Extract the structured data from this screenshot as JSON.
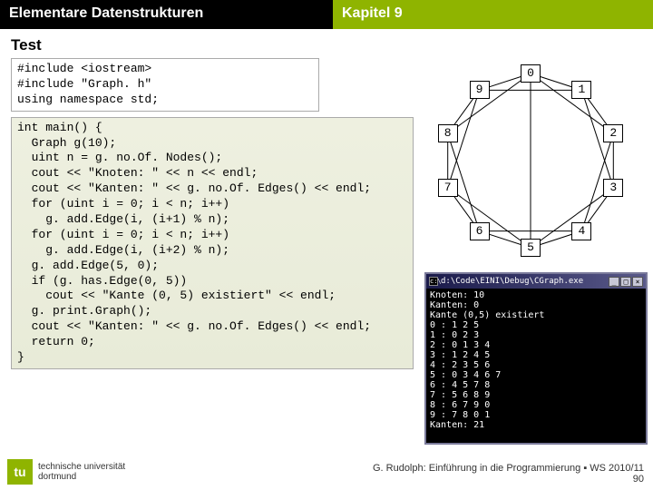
{
  "header": {
    "left": "Elementare Datenstrukturen",
    "right": "Kapitel 9"
  },
  "section": "Test",
  "code_top": "#include <iostream>\n#include \"Graph. h\"\nusing namespace std;",
  "code_main": "int main() {\n  Graph g(10);\n  uint n = g. no.Of. Nodes();\n  cout << \"Knoten: \" << n << endl;\n  cout << \"Kanten: \" << g. no.Of. Edges() << endl;\n  for (uint i = 0; i < n; i++)\n    g. add.Edge(i, (i+1) % n);\n  for (uint i = 0; i < n; i++)\n    g. add.Edge(i, (i+2) % n);\n  g. add.Edge(5, 0);\n  if (g. has.Edge(0, 5))\n    cout << \"Kante (0, 5) existiert\" << endl;\n  g. print.Graph();\n  cout << \"Kanten: \" << g. no.Of. Edges() << endl;\n  return 0;\n}",
  "nodes": [
    "0",
    "1",
    "2",
    "3",
    "4",
    "5",
    "6",
    "7",
    "8",
    "9"
  ],
  "console": {
    "title": "d:\\Code\\EINI\\Debug\\CGraph.exe",
    "lines": [
      "Knoten: 10",
      "Kanten: 0",
      "Kante (0,5) existiert",
      "0 : 1 2 5",
      "1 : 0 2 3",
      "2 : 0 1 3 4",
      "3 : 1 2 4 5",
      "4 : 2 3 5 6",
      "5 : 0 3 4 6 7",
      "6 : 4 5 7 8",
      "7 : 5 6 8 9",
      "8 : 6 7 9 0",
      "9 : 7 8 0 1",
      "Kanten: 21"
    ]
  },
  "logo": {
    "tu": "tu",
    "uni_line1": "technische universität",
    "uni_line2": "dortmund"
  },
  "footer": {
    "line1": "G. Rudolph: Einführung in die Programmierung ▪ WS 2010/11",
    "line2": "90"
  }
}
